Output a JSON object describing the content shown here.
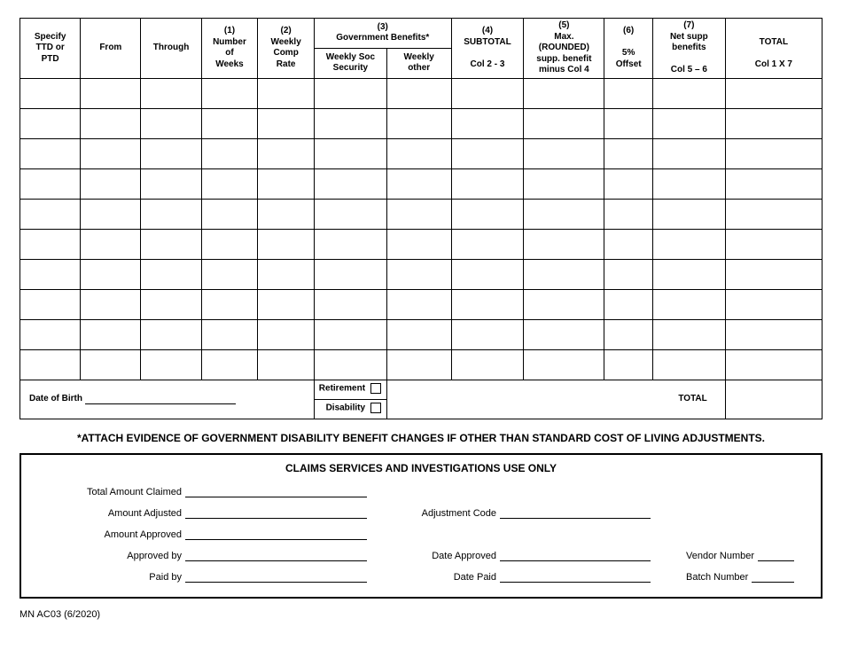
{
  "table": {
    "headers": {
      "specify": [
        "Specify",
        "TTD or",
        "PTD"
      ],
      "from": "From",
      "through": "Through",
      "col1_num": "(1)",
      "col1_lines": [
        "Number",
        "of",
        "Weeks"
      ],
      "col2_num": "(2)",
      "col2_lines": [
        "Weekly",
        "Comp",
        "Rate"
      ],
      "col3_num": "(3)",
      "col3_label": "Government Benefits*",
      "col3a": [
        "Weekly Soc",
        "Security"
      ],
      "col3b": [
        "Weekly",
        "other"
      ],
      "col4_num": "(4)",
      "col4_top": "SUBTOTAL",
      "col4_bot": "Col 2 - 3",
      "col5_num": "(5)",
      "col5_lines": [
        "Max.",
        "(ROUNDED)",
        "supp. benefit",
        "minus Col 4"
      ],
      "col6_num": "(6)",
      "col6_lines": [
        "5%",
        "Offset"
      ],
      "col7_num": "(7)",
      "col7_top": [
        "Net supp",
        "benefits"
      ],
      "col7_bot": "Col 5 – 6",
      "total_top": "TOTAL",
      "total_bot": "Col 1 X 7"
    },
    "row_count": 10,
    "dob_label": "Date of Birth",
    "retirement_label": "Retirement",
    "disability_label": "Disability",
    "total_label": "TOTAL"
  },
  "attach_note": "*ATTACH EVIDENCE OF GOVERNMENT DISABILITY BENEFIT CHANGES IF OTHER THAN STANDARD COST OF LIVING ADJUSTMENTS.",
  "claims": {
    "title": "CLAIMS SERVICES AND INVESTIGATIONS USE ONLY",
    "total_amount_claimed": "Total Amount Claimed",
    "amount_adjusted": "Amount Adjusted",
    "adjustment_code": "Adjustment Code",
    "amount_approved": "Amount Approved",
    "approved_by": "Approved by",
    "date_approved": "Date Approved",
    "vendor_number": "Vendor Number",
    "paid_by": "Paid by",
    "date_paid": "Date Paid",
    "batch_number": "Batch Number"
  },
  "footer": "MN AC03 (6/2020)"
}
